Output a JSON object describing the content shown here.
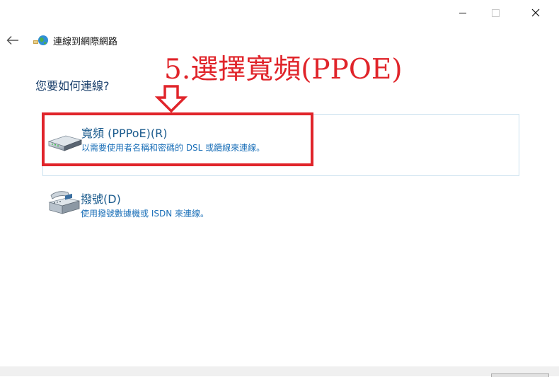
{
  "window": {
    "title": "連線到網際網路",
    "controls": [
      "minimize-icon",
      "maximize-icon",
      "close-icon"
    ]
  },
  "nav": {
    "back_icon": "back-arrow-icon"
  },
  "annotation": {
    "text": "5.選擇寬頻(PPOE)",
    "color": "#e0242a"
  },
  "prompt": {
    "question": "您要如何連線?"
  },
  "options": [
    {
      "icon": "broadband-modem-icon",
      "title": "寬頻 (PPPoE)(R)",
      "description": "以需要使用者名稱和密碼的 DSL 或纜線來連線。",
      "highlighted": true
    },
    {
      "icon": "dialup-phone-icon",
      "title": "撥號(D)",
      "description": "使用撥號數據機或 ISDN 來連線。",
      "highlighted": false
    }
  ],
  "colors": {
    "title_blue": "#1c5c8e",
    "link_blue": "#1a6fb8",
    "annotation_red": "#e0242a"
  }
}
